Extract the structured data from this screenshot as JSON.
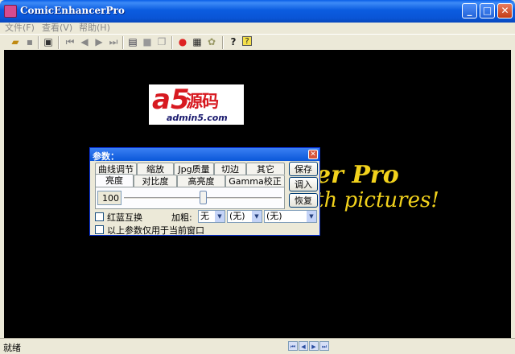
{
  "window": {
    "title": "ComicEnhancerPro"
  },
  "menu": {
    "items": [
      "文件(F)",
      "查看(V)",
      "帮助(H)"
    ]
  },
  "toolbar": {
    "icons": [
      "open-icon",
      "save-icon",
      "save-as-icon",
      "first-icon",
      "prev-icon",
      "next-icon",
      "last-icon",
      "copy-window-icon",
      "rect-icon",
      "duplicate-icon",
      "color-icon",
      "filmstrip-icon",
      "settings-icon",
      "help-icon",
      "about-icon"
    ]
  },
  "splash": {
    "logo_a": "a5",
    "logo_cn": "源码",
    "logo_url": "admin5.com",
    "title_fragment": "er Pro",
    "subtitle_fragment": "th pictures!"
  },
  "dialog": {
    "title": "参数：",
    "tabs_row1": [
      "曲线调节",
      "缩放",
      "Jpg质量",
      "切边",
      "其它"
    ],
    "tabs_row2": [
      "亮度",
      "对比度",
      "高亮度",
      "Gamma校正"
    ],
    "value": "100",
    "slider_level": 0.5,
    "buttons": {
      "save": "保存",
      "load": "调入",
      "restore": "恢复"
    },
    "swap_rb_label": "红蓝互换",
    "bold_label": "加粗:",
    "bold_value": "无",
    "combo2_value": "(无)",
    "combo3_value": "(无)",
    "apply_label": "以上参数仅用于当前窗口"
  },
  "statusbar": {
    "text": "就绪"
  },
  "colors": {
    "titlebar": "#0a55d6",
    "canvas": "#000000",
    "splash_text": "#f2d21c",
    "logo_red": "#d71920"
  }
}
